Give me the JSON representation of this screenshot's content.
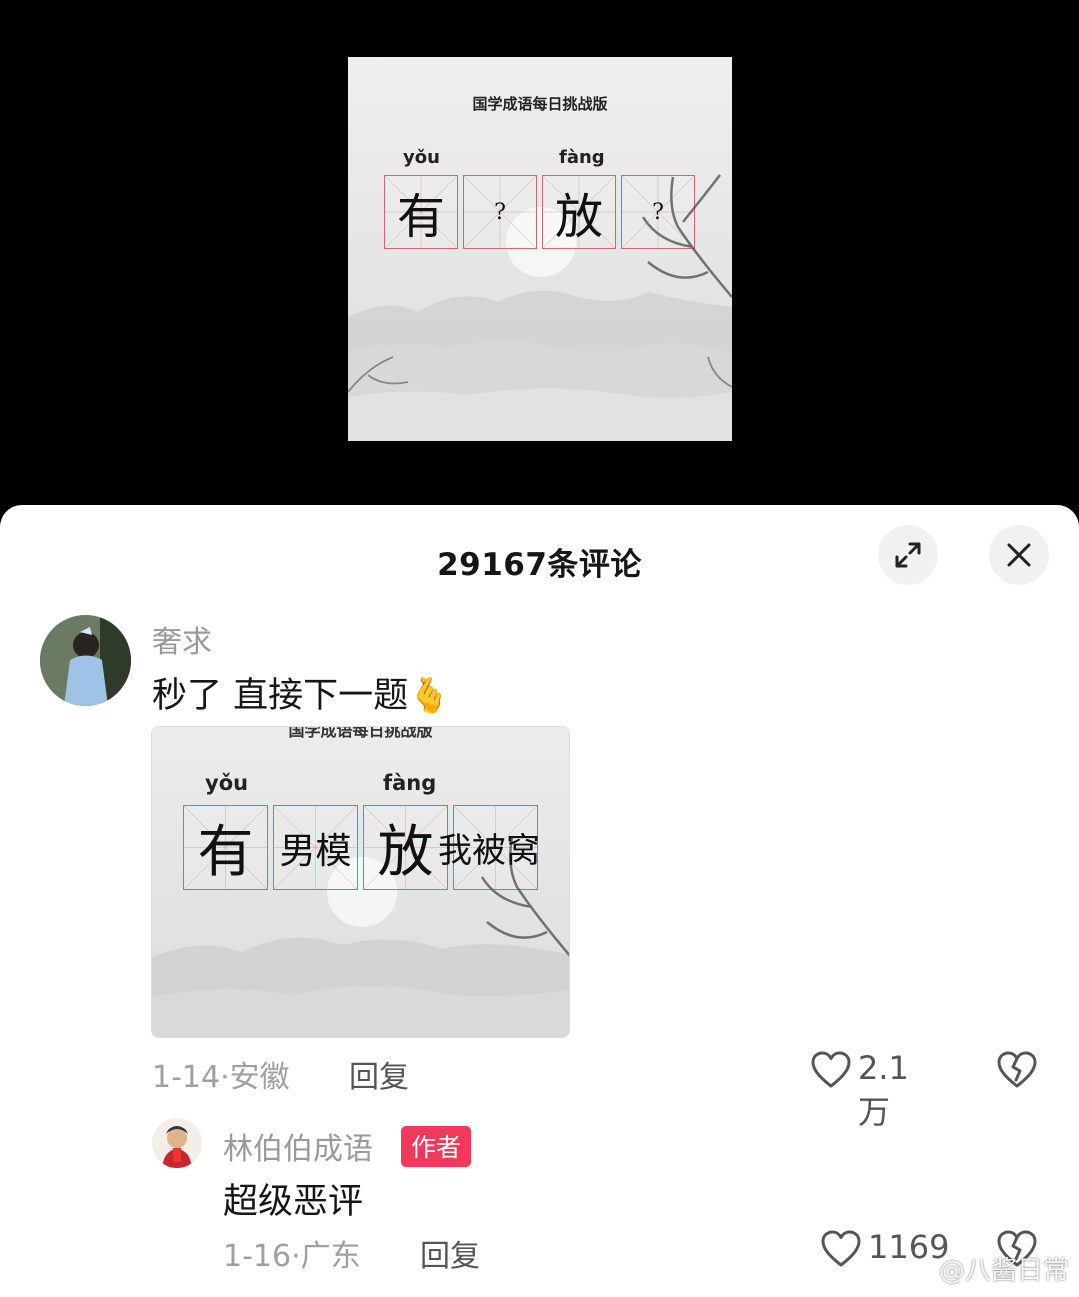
{
  "puzzle": {
    "title": "国学成语每日挑战版",
    "pinyin": [
      "yǒu",
      "fàng"
    ],
    "cells": [
      "有",
      "?",
      "放",
      "?"
    ]
  },
  "comments_header": {
    "title": "29167条评论",
    "expand_icon": "expand-icon",
    "close_icon": "close-icon"
  },
  "comments": [
    {
      "username": "奢求",
      "text": "秒了 直接下一题",
      "emoji": "🫰",
      "attachment": {
        "pinyin": [
          "yǒu",
          "fàng"
        ],
        "cells": [
          "有",
          "男模",
          "放",
          "我被窝"
        ]
      },
      "date": "1-14",
      "location": "安徽",
      "reply_label": "回复",
      "likes": "2.1万"
    },
    {
      "username": "林伯伯成语",
      "badge": "作者",
      "text": "超级恶评",
      "date": "1-16",
      "location": "广东",
      "reply_label": "回复",
      "likes": "1169"
    }
  ],
  "watermark": "@八酱日常",
  "colors": {
    "badge": "#f2395c",
    "grid": "#c86a6a"
  }
}
